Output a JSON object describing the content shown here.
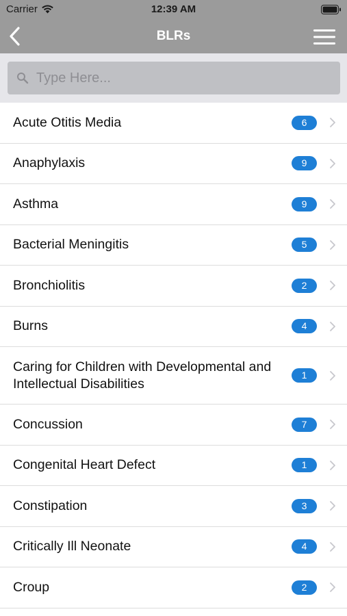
{
  "status_bar": {
    "carrier": "Carrier",
    "time": "12:39 AM",
    "background": "#9b9b9b"
  },
  "nav": {
    "title": "BLRs",
    "back_icon": "chevron-left-icon",
    "menu_icon": "hamburger-menu-icon"
  },
  "search": {
    "placeholder": "Type Here...",
    "value": ""
  },
  "accent_color": "#1e7fd6",
  "items": [
    {
      "label": "Acute Otitis Media",
      "count": "6"
    },
    {
      "label": "Anaphylaxis",
      "count": "9"
    },
    {
      "label": "Asthma",
      "count": "9"
    },
    {
      "label": "Bacterial Meningitis",
      "count": "5"
    },
    {
      "label": "Bronchiolitis",
      "count": "2"
    },
    {
      "label": "Burns",
      "count": "4"
    },
    {
      "label": "Caring for Children with Developmental and Intellectual Disabilities",
      "count": "1"
    },
    {
      "label": "Concussion",
      "count": "7"
    },
    {
      "label": "Congenital Heart Defect",
      "count": "1"
    },
    {
      "label": "Constipation",
      "count": "3"
    },
    {
      "label": "Critically Ill Neonate",
      "count": "4"
    },
    {
      "label": "Croup",
      "count": "2"
    }
  ]
}
